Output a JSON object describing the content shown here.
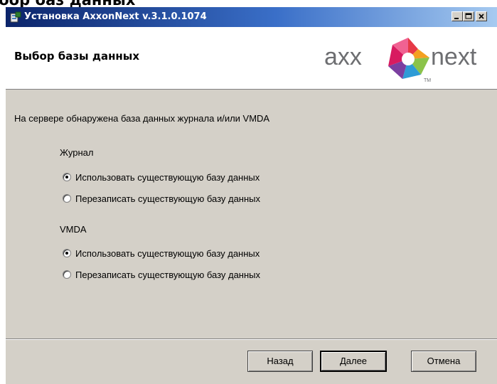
{
  "page": {
    "heading": "бор баз данных"
  },
  "window": {
    "title": "Установка AxxonNext v.3.1.0.1074",
    "title_buttons": {
      "minimize": "minimize-icon",
      "maximize": "maximize-icon",
      "close": "close-icon"
    }
  },
  "header": {
    "title": "Выбор базы данных",
    "logo": {
      "left_text": "axx",
      "right_text": "next",
      "mark": "TM"
    }
  },
  "content": {
    "intro": "На сервере обнаружена база данных журнала и/или VMDA",
    "groups": [
      {
        "label": "Журнал",
        "options": [
          {
            "label": "Использовать существующую базу данных",
            "checked": true
          },
          {
            "label": "Перезаписать существующую базу данных",
            "checked": false
          }
        ]
      },
      {
        "label": "VMDA",
        "options": [
          {
            "label": "Использовать существующую базу данных",
            "checked": true
          },
          {
            "label": "Перезаписать существующую базу данных",
            "checked": false
          }
        ]
      }
    ]
  },
  "buttons": {
    "back": "Назад",
    "next": "Далее",
    "cancel": "Отмена"
  },
  "colors": {
    "dialog_bg": "#d4d0c8",
    "titlebar_start": "#0b246a",
    "titlebar_end": "#a6caf0"
  }
}
